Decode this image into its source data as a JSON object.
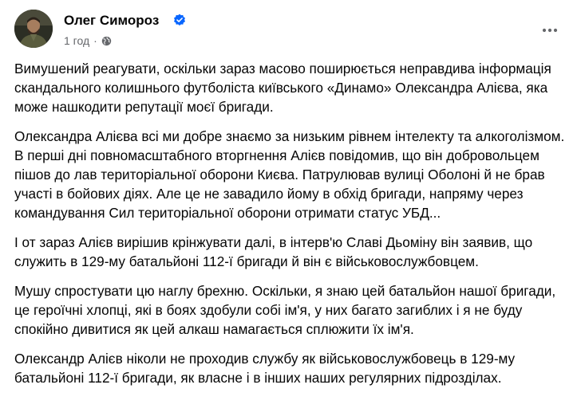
{
  "post": {
    "author": "Олег Симороз",
    "timestamp": "1 год",
    "separator": "·",
    "paragraphs": [
      "Вимушений реагувати, оскільки зараз масово поширюється неправдива інформація скандального колишнього футболіста київського «Динамо» Олександра Алієва, яка може нашкодити репутації моєї бригади.",
      "Олександра Алієва всі ми добре знаємо за низьким рівнем інтелекту та алкоголізмом. В перші дні повномасштабного вторгнення Алієв повідомив, що він добровольцем пішов до лав територіальної оборони Києва. Патрулював вулиці Оболоні й не брав участі в бойових діях. Але це не завадило йому в обхід бригади, напряму через командування Сил територіальної оборони отримати статус УБД...",
      "І от зараз Алієв вирішив крінжувати далі, в інтерв'ю Славі Дьоміну він заявив, що служить в 129-му батальйоні 112-ї бригади й він є військовослужбовцем.",
      "Мушу спростувати цю наглу брехню. Оскільки, я знаю цей батальйон нашої бригади, це героїчні хлопці, які в боях здобули собі ім'я, у них багато загиблих і я не буду спокійно дивитися як цей алкаш намагається сплюжити їх ім'я.",
      "Олександр Алієв ніколи не проходив службу як військовослужбовець в 129-му батальйоні 112-ї бригади, як власне і в інших наших регулярних підрозділах."
    ]
  },
  "icons": {
    "verified": "verified-badge-icon",
    "audience": "globe-icon",
    "more": "more-options-icon"
  },
  "colors": {
    "verified": "#0866ff",
    "secondary_text": "#65676b",
    "primary_text": "#050505"
  }
}
